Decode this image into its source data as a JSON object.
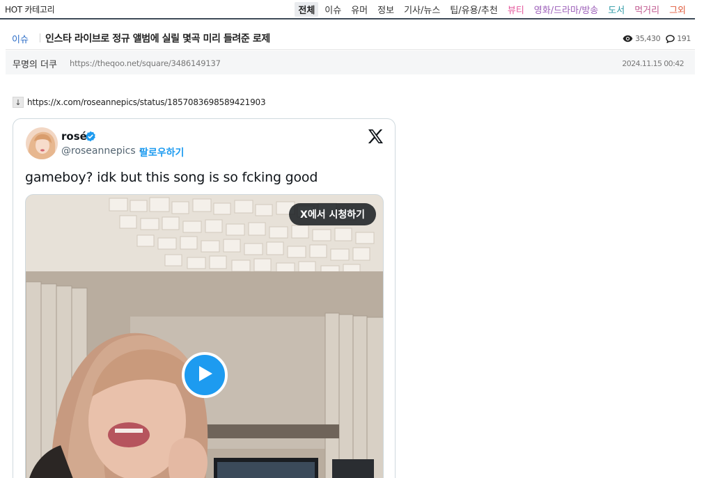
{
  "nav": {
    "hot_label": "HOT 카테고리",
    "categories": [
      {
        "label": "전체",
        "color": "#222222",
        "active": true
      },
      {
        "label": "이슈",
        "color": "#333333"
      },
      {
        "label": "유머",
        "color": "#333333"
      },
      {
        "label": "정보",
        "color": "#333333"
      },
      {
        "label": "기사/뉴스",
        "color": "#333333"
      },
      {
        "label": "팁/유용/추천",
        "color": "#333333"
      },
      {
        "label": "뷰티",
        "color": "#e4559a"
      },
      {
        "label": "영화/드라마/방송",
        "color": "#9b5db8"
      },
      {
        "label": "도서",
        "color": "#2e9aa6"
      },
      {
        "label": "먹거리",
        "color": "#c0598f"
      },
      {
        "label": "그외",
        "color": "#e05a3b"
      }
    ]
  },
  "post": {
    "board": "이슈",
    "title": "인스타 라이브로 정규 앨범에 실릴 몇곡 미리 들려준 로제",
    "views": "35,430",
    "comments": "191",
    "author": "무명의 더쿠",
    "url": "https://theqoo.net/square/3486149137",
    "date": "2024.11.15 00:42",
    "link_arrow": "↓",
    "link": "https://x.com/roseannepics/status/1857083698589421903"
  },
  "tweet": {
    "name": "rosé",
    "handle": "@roseannepics",
    "dot": "·",
    "follow_label": "팔로우하기",
    "text": "gameboy? idk but this song is so fcking good",
    "watch_label": "X에서 시청하기",
    "icons": {
      "verified": "verified-badge-icon",
      "x_logo": "x-logo-icon",
      "play": "play-icon",
      "views": "eye-icon",
      "comments": "comment-icon"
    },
    "accent_color": "#1d9bf0"
  }
}
